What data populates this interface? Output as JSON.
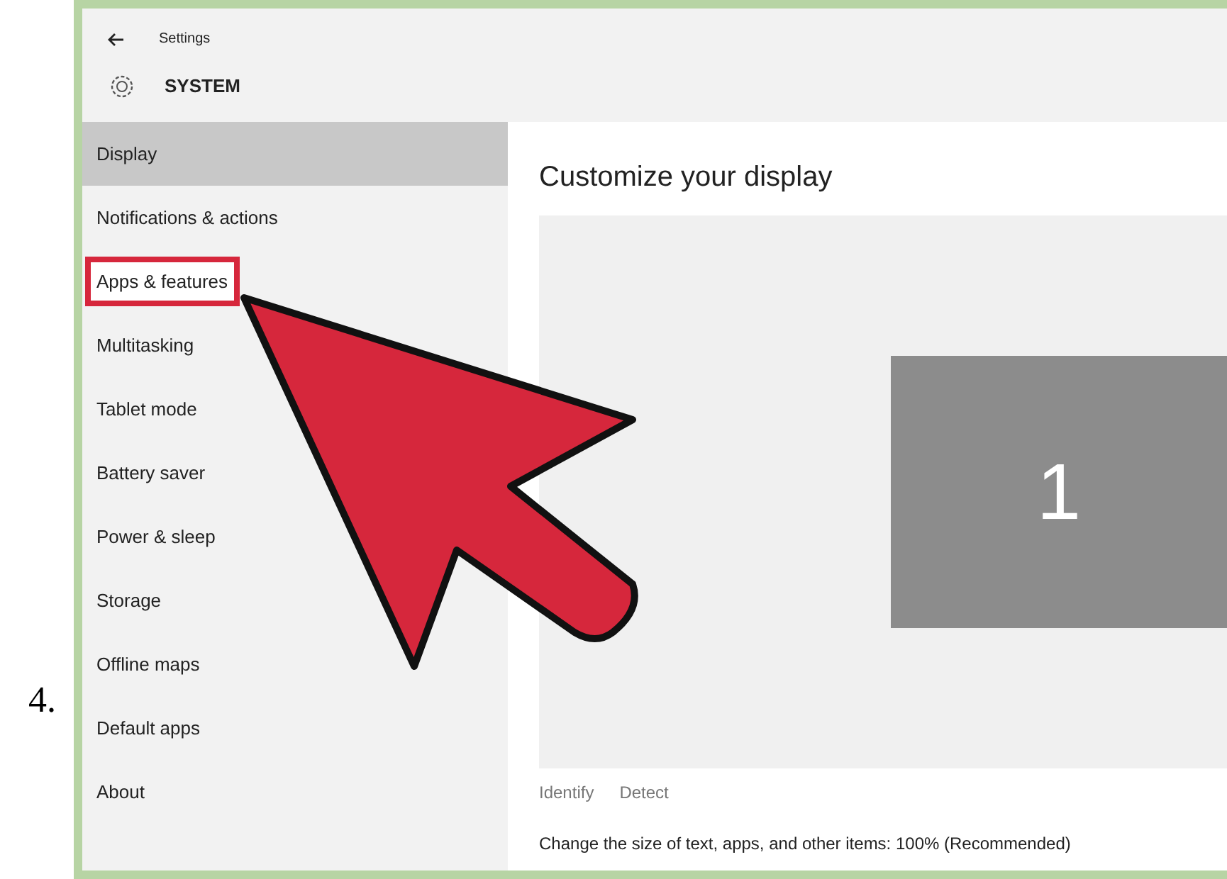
{
  "step_number": "4.",
  "window": {
    "title": "Settings",
    "section": "SYSTEM"
  },
  "sidebar": {
    "items": [
      {
        "label": "Display",
        "selected": true,
        "highlighted": false
      },
      {
        "label": "Notifications & actions",
        "selected": false,
        "highlighted": false
      },
      {
        "label": "Apps & features",
        "selected": false,
        "highlighted": true
      },
      {
        "label": "Multitasking",
        "selected": false,
        "highlighted": false
      },
      {
        "label": "Tablet mode",
        "selected": false,
        "highlighted": false
      },
      {
        "label": "Battery saver",
        "selected": false,
        "highlighted": false
      },
      {
        "label": "Power & sleep",
        "selected": false,
        "highlighted": false
      },
      {
        "label": "Storage",
        "selected": false,
        "highlighted": false
      },
      {
        "label": "Offline maps",
        "selected": false,
        "highlighted": false
      },
      {
        "label": "Default apps",
        "selected": false,
        "highlighted": false
      },
      {
        "label": "About",
        "selected": false,
        "highlighted": false
      }
    ]
  },
  "main": {
    "title": "Customize your display",
    "monitor_number": "1",
    "links": [
      "Identify",
      "Detect"
    ],
    "scale_text": "Change the size of text, apps, and other items: 100% (Recommended)"
  }
}
